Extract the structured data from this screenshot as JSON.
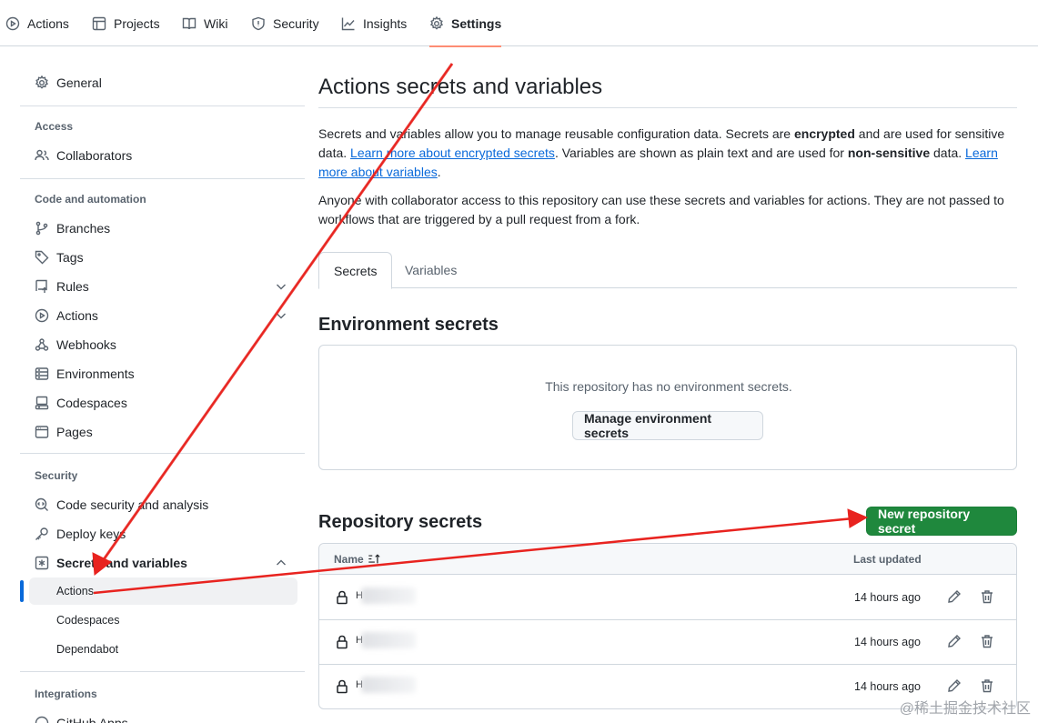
{
  "topnav": {
    "tabs": [
      {
        "label": "Actions",
        "icon": "play-icon"
      },
      {
        "label": "Projects",
        "icon": "table-icon"
      },
      {
        "label": "Wiki",
        "icon": "book-icon"
      },
      {
        "label": "Security",
        "icon": "shield-icon"
      },
      {
        "label": "Insights",
        "icon": "graph-icon"
      },
      {
        "label": "Settings",
        "icon": "gear-icon",
        "active": true
      }
    ]
  },
  "sidebar": {
    "general": "General",
    "access_heading": "Access",
    "collaborators": "Collaborators",
    "code_heading": "Code and automation",
    "branches": "Branches",
    "tags": "Tags",
    "rules": "Rules",
    "actions": "Actions",
    "webhooks": "Webhooks",
    "environments": "Environments",
    "codespaces": "Codespaces",
    "pages": "Pages",
    "security_heading": "Security",
    "code_security": "Code security and analysis",
    "deploy_keys": "Deploy keys",
    "secrets_variables": "Secrets and variables",
    "sub_actions": "Actions",
    "sub_codespaces": "Codespaces",
    "sub_dependabot": "Dependabot",
    "integrations_heading": "Integrations",
    "github_apps": "GitHub Apps"
  },
  "main": {
    "title": "Actions secrets and variables",
    "para1_a": "Secrets and variables allow you to manage reusable configuration data. Secrets are ",
    "para1_b": "encrypted",
    "para1_c": " and are used for sensitive data. ",
    "para1_link1": "Learn more about encrypted secrets",
    "para1_d": ". Variables are shown as plain text and are used for ",
    "para1_e": "non-sensitive",
    "para1_f": " data. ",
    "para1_link2": "Learn more about variables",
    "para1_g": ".",
    "para2": "Anyone with collaborator access to this repository can use these secrets and variables for actions. They are not passed to workflows that are triggered by a pull request from a fork.",
    "tabs": {
      "secrets": "Secrets",
      "variables": "Variables"
    },
    "env_title": "Environment secrets",
    "env_empty": "This repository has no environment secrets.",
    "env_button": "Manage environment secrets",
    "repo_title": "Repository secrets",
    "new_button": "New repository secret",
    "table": {
      "col_name": "Name",
      "col_updated": "Last updated",
      "rows": [
        {
          "name": "H",
          "updated": "14 hours ago"
        },
        {
          "name": "H",
          "updated": "14 hours ago"
        },
        {
          "name": "H",
          "updated": "14 hours ago"
        }
      ]
    }
  },
  "watermark": "@稀土掘金技术社区",
  "colors": {
    "primary_button": "#1f883d",
    "link": "#0969da",
    "annotation_arrow": "#e8231f",
    "active_tab_underline": "#fd8c73"
  }
}
